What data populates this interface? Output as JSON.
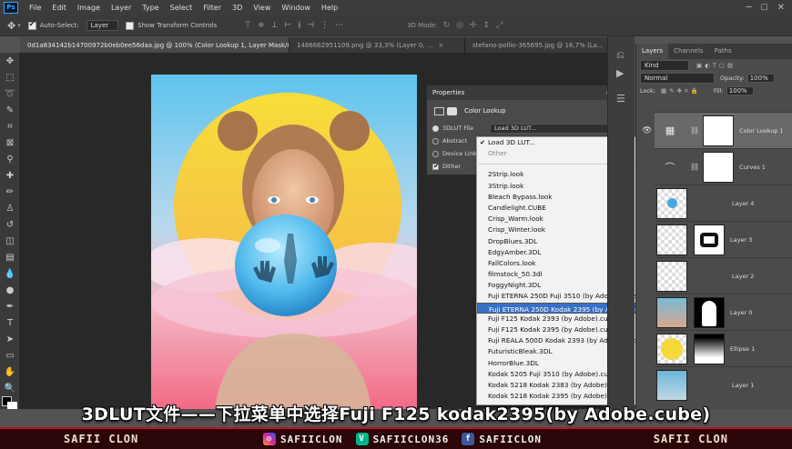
{
  "menu": [
    "File",
    "Edit",
    "Image",
    "Layer",
    "Type",
    "Select",
    "Filter",
    "3D",
    "View",
    "Window",
    "Help"
  ],
  "options": {
    "auto_select": "Auto-Select:",
    "auto_select_value": "Layer",
    "transform": "Show Transform Controls",
    "mode3d": "3D Mode:"
  },
  "tabs": [
    {
      "label": "0d1a834142b14700972b0eb0ee56daa.jpg @ 100% (Color Lookup 1, Layer Mask/8) *",
      "active": true
    },
    {
      "label": "1486662951109.png @ 33,3% (Layer 0, ...",
      "active": false
    },
    {
      "label": "stefano-pollio-365695.jpg @ 16,7% (La...",
      "active": false
    }
  ],
  "properties": {
    "title": "Properties",
    "section": "Color Lookup",
    "lut_file_label": "3DLUT File",
    "lut_file_value": "Load 3D LUT...",
    "abstract": "Abstract",
    "device_link": "Device Link",
    "dither": "Dither"
  },
  "lut_menu": {
    "top": [
      "Load 3D LUT...",
      "Other"
    ],
    "items": [
      "2Strip.look",
      "3Strip.look",
      "Bleach Bypass.look",
      "Candlelight.CUBE",
      "Crisp_Warm.look",
      "Crisp_Winter.look",
      "DropBlues.3DL",
      "EdgyAmber.3DL",
      "FallColors.look",
      "filmstock_50.3dl",
      "FoggyNight.3DL",
      "Fuji ETERNA 250D Fuji 3510 (by Adobe).cube",
      "Fuji ETERNA 250D Kodak 2395 (by Adobe).cube",
      "Fuji F125 Kodak 2393 (by Adobe).cube",
      "Fuji F125 Kodak 2395 (by Adobe).cube",
      "Fuji REALA 500D Kodak 2393 (by Adobe).cube",
      "FuturisticBleak.3DL",
      "HorrorBlue.3DL",
      "Kodak 5205 Fuji 3510 (by Adobe).cube",
      "Kodak 5218 Kodak 2383 (by Adobe).cube",
      "Kodak 5218 Kodak 2395 (by Adobe).cube"
    ],
    "selected": "Fuji ETERNA 250D Kodak 2395 (by Adobe).cube"
  },
  "layers_panel": {
    "tabs": [
      "Layers",
      "Channels",
      "Paths"
    ],
    "kind": "Kind",
    "blend": "Normal",
    "opacity_label": "Opacity:",
    "opacity": "100%",
    "lock_label": "Lock:",
    "fill_label": "Fill:",
    "fill": "100%",
    "layers": [
      "Color Lookup 1",
      "Curves 1",
      "Layer 4",
      "Layer 3",
      "Layer 2",
      "Layer 0",
      "Ellipse 1",
      "Layer 1"
    ]
  },
  "subtitle": "3DLUT文件——下拉菜单中选择Fuji F125 kodak2395(by Adobe.cube)",
  "footer": {
    "brand_left": "SAFII CLON",
    "instagram": "SAFIICLON",
    "vine": "SAFIICLON36",
    "facebook": "SAFIICLON",
    "brand_right": "SAFII CLON"
  },
  "colors": {
    "accent": "#3870c8",
    "footer_red": "#c4141d"
  }
}
